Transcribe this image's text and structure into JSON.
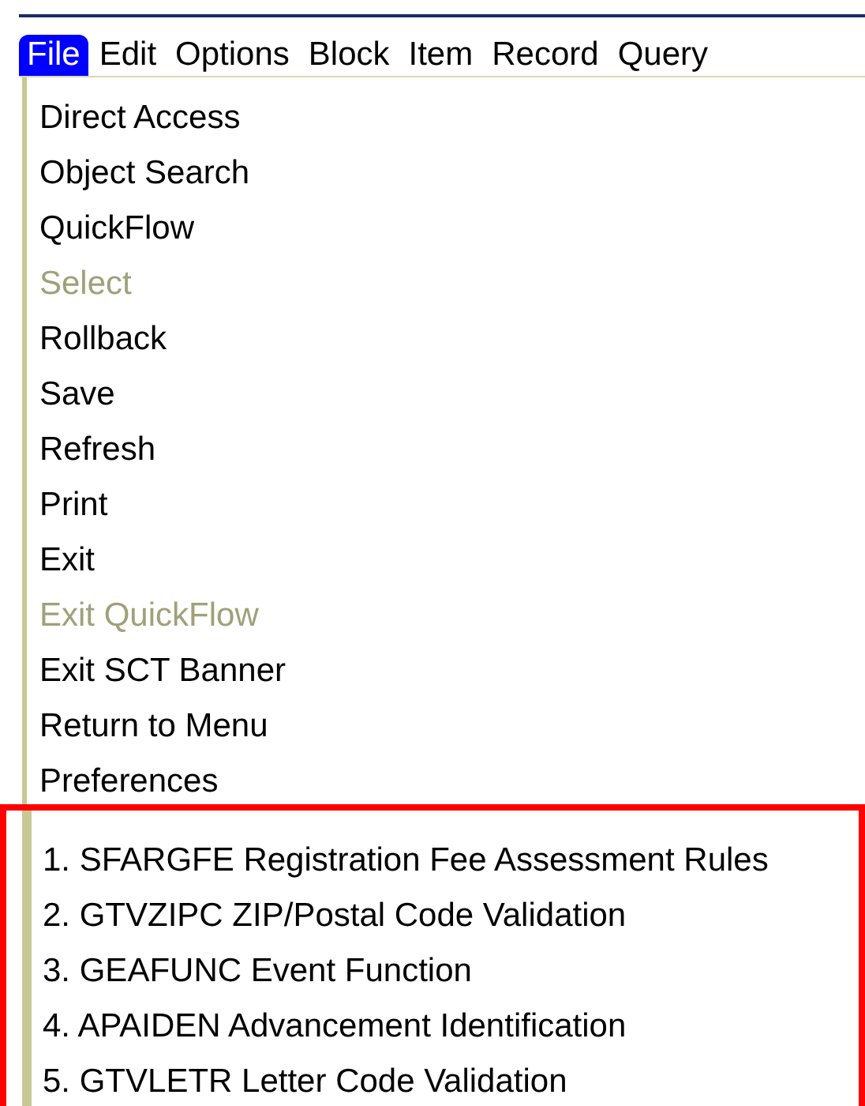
{
  "menubar": [
    {
      "label": "File",
      "selected": true
    },
    {
      "label": "Edit",
      "selected": false
    },
    {
      "label": "Options",
      "selected": false
    },
    {
      "label": "Block",
      "selected": false
    },
    {
      "label": "Item",
      "selected": false
    },
    {
      "label": "Record",
      "selected": false
    },
    {
      "label": "Query",
      "selected": false
    }
  ],
  "menu_items": [
    {
      "label": "Direct Access",
      "disabled": false
    },
    {
      "label": "Object Search",
      "disabled": false
    },
    {
      "label": "QuickFlow",
      "disabled": false
    },
    {
      "label": "Select",
      "disabled": true
    },
    {
      "label": "Rollback",
      "disabled": false
    },
    {
      "label": "Save",
      "disabled": false
    },
    {
      "label": "Refresh",
      "disabled": false
    },
    {
      "label": "Print",
      "disabled": false
    },
    {
      "label": "Exit",
      "disabled": false
    },
    {
      "label": "Exit QuickFlow",
      "disabled": true
    },
    {
      "label": "Exit SCT Banner",
      "disabled": false
    },
    {
      "label": "Return to Menu",
      "disabled": false
    },
    {
      "label": "Preferences",
      "disabled": false
    }
  ],
  "recent_items": [
    {
      "label": "1. SFARGFE Registration Fee Assessment Rules"
    },
    {
      "label": "2. GTVZIPC ZIP/Postal Code Validation"
    },
    {
      "label": "3. GEAFUNC Event Function"
    },
    {
      "label": "4. APAIDEN Advancement Identification"
    },
    {
      "label": "5. GTVLETR Letter Code Validation"
    }
  ]
}
